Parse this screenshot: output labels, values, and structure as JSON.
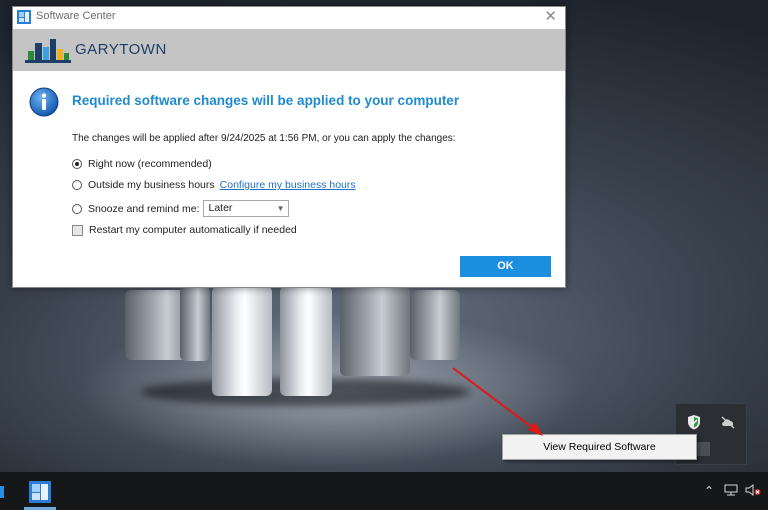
{
  "dialog": {
    "window_title": "Software Center",
    "close_glyph": "✕",
    "brand": "GARYTOWN",
    "heading": "Required software changes will be applied to your computer",
    "description": "The changes will be applied after 9/24/2025 at 1:56 PM, or you can apply the changes:",
    "options": {
      "right_now": "Right now (recommended)",
      "outside_hours": "Outside my business hours",
      "configure_link": "Configure my business hours",
      "snooze": "Snooze and remind me:",
      "snooze_value": "Later",
      "restart": "Restart my computer automatically if needed"
    },
    "selected_option": "right_now",
    "restart_checked": false,
    "ok_label": "OK"
  },
  "context_menu": {
    "items": [
      "View Required Software"
    ]
  },
  "colors": {
    "accent": "#1c8ede",
    "heading": "#1f8ad0",
    "brand_bar": "#c4c4c4",
    "arrow": "#e01818"
  },
  "icons": [
    "software-center-icon",
    "garytown-logo",
    "info-icon",
    "chevron-down-icon",
    "security-shield-icon",
    "cloud-offline-icon",
    "chevron-up-icon",
    "network-icon",
    "volume-muted-icon"
  ]
}
